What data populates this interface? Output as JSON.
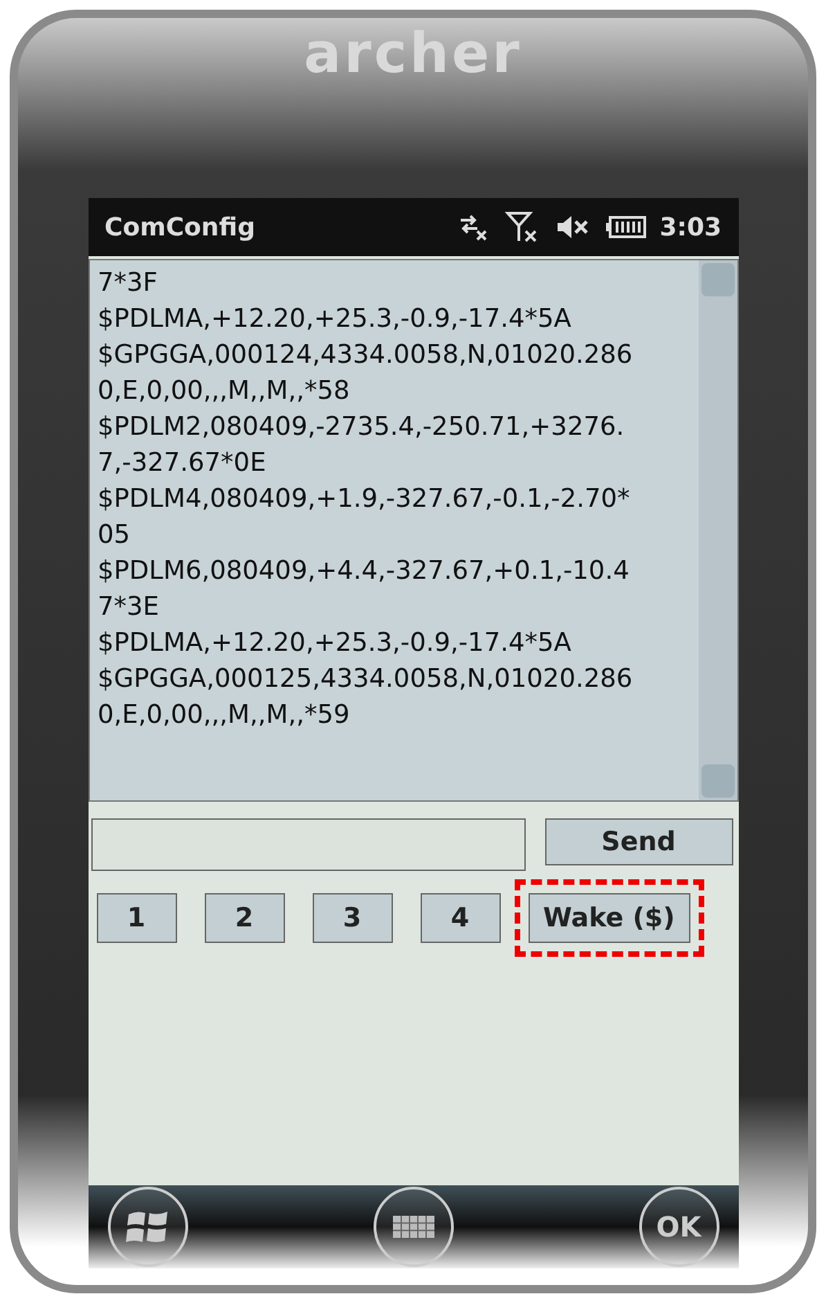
{
  "device": {
    "brand": "archer"
  },
  "title_bar": {
    "title": "ComConfig",
    "time": "3:03"
  },
  "log": {
    "lines": [
      "7*3F",
      "$PDLMA,+12.20,+25.3,-0.9,-17.4*5A",
      "$GPGGA,000124,4334.0058,N,01020.286",
      "0,E,0,00,,,M,,M,,*58",
      "$PDLM2,080409,-2735.4,-250.71,+3276.",
      "7,-327.67*0E",
      "$PDLM4,080409,+1.9,-327.67,-0.1,-2.70*",
      "05",
      "$PDLM6,080409,+4.4,-327.67,+0.1,-10.4",
      "7*3E",
      "$PDLMA,+12.20,+25.3,-0.9,-17.4*5A",
      "$GPGGA,000125,4334.0058,N,01020.286",
      "0,E,0,00,,,M,,M,,*59"
    ]
  },
  "send_button": {
    "label": "Send"
  },
  "buttons": [
    {
      "label": "1",
      "highlighted": false
    },
    {
      "label": "2",
      "highlighted": false
    },
    {
      "label": "3",
      "highlighted": false
    },
    {
      "label": "4",
      "highlighted": false
    },
    {
      "label": "Wake ($)",
      "highlighted": true
    }
  ],
  "soft_keys": [
    {
      "kind": "start"
    },
    {
      "kind": "keyboard"
    },
    {
      "kind": "ok",
      "label": "OK"
    }
  ]
}
